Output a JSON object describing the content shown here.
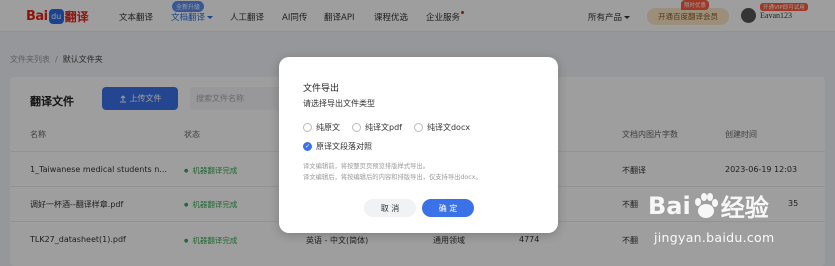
{
  "header": {
    "logo": {
      "bai": "Bai",
      "paw": "du",
      "fanyi": "翻译"
    },
    "nav": [
      {
        "label": "文本翻译"
      },
      {
        "label": "文档翻译",
        "badge": "全新升级"
      },
      {
        "label": "人工翻译"
      },
      {
        "label": "AI同传"
      },
      {
        "label": "翻译API"
      },
      {
        "label": "课程优选"
      },
      {
        "label": "企业服务"
      }
    ],
    "all_products": "所有产品",
    "vip_button": "开通百度翻译会员",
    "vip_tag": "限时优惠",
    "user_tag": "开通VIP即可试用",
    "username": "Eavan123"
  },
  "breadcrumb": {
    "root": "文件夹列表",
    "sep": "/",
    "current": "默认文件夹"
  },
  "main": {
    "title": "翻译文件",
    "upload_button": "上传文件",
    "search_placeholder": "搜索文件名称",
    "columns": [
      "名称",
      "状态",
      "文档内图片字数",
      "创建时间"
    ],
    "rows": [
      {
        "name": "1_Taiwanese medical students n...",
        "status": "机器翻译完成",
        "img_words": "不翻译",
        "created": "2023-06-19 12:03"
      },
      {
        "name": "调好一杯酒--翻译样章.pdf",
        "status": "机器翻译完成",
        "img_words": "不翻",
        "created": "35"
      },
      {
        "name": "TLK27_datasheet(1).pdf",
        "status": "机器翻译完成",
        "lang": "英语 - 中文(简体)",
        "domain": "通用领域",
        "count": "4774",
        "img_words": "不翻",
        "created": ""
      }
    ]
  },
  "dialog": {
    "title": "文件导出",
    "subtitle": "请选择导出文件类型",
    "options": [
      {
        "label": "纯原文",
        "checked": false
      },
      {
        "label": "纯译文pdf",
        "checked": false
      },
      {
        "label": "纯译文docx",
        "checked": false
      },
      {
        "label": "原译文段落对照",
        "checked": true
      }
    ],
    "note1": "译文编辑前，将按整页页预览排版样式导出。",
    "note2": "译文编辑后，将按编辑后的内容和排版导出，仅支持导出docx。",
    "cancel": "取 消",
    "ok": "确 定"
  },
  "watermark": {
    "brand": "Bai",
    "brand2": "经验",
    "url": "jingyan.baidu.com"
  }
}
